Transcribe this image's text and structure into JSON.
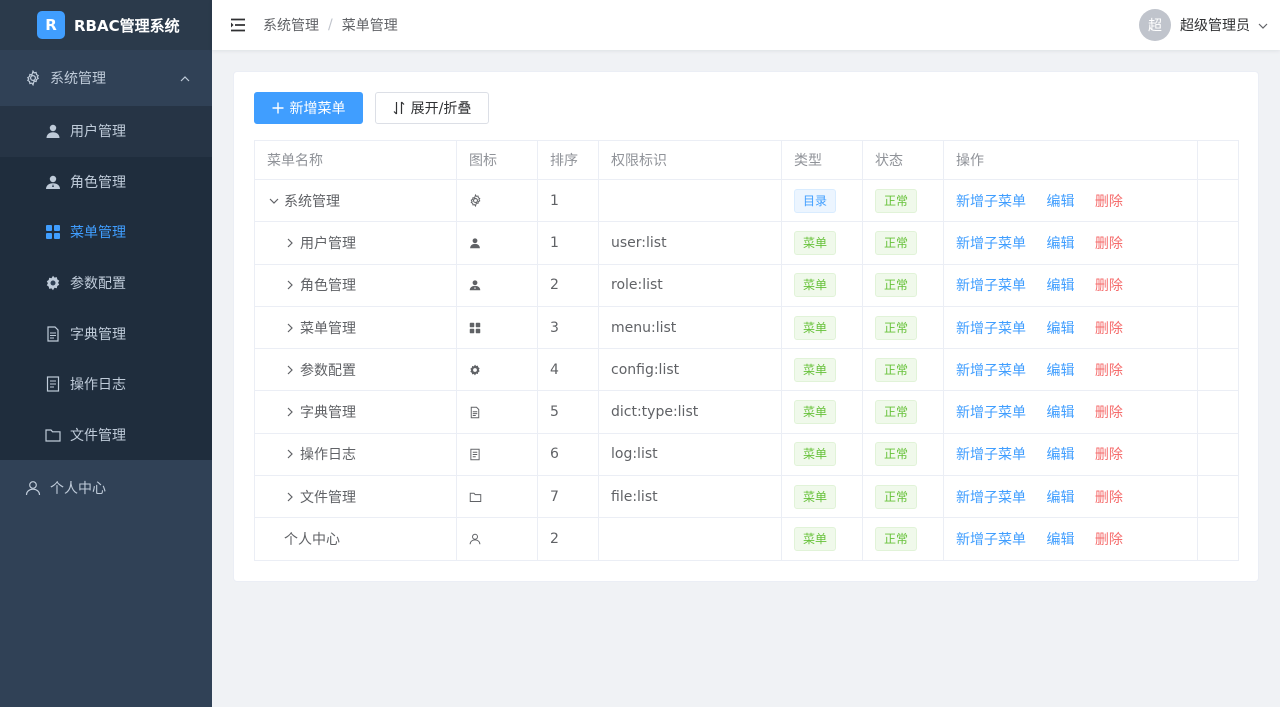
{
  "app": {
    "logo_letter": "R",
    "title": "RBAC管理系统"
  },
  "sidebar": {
    "group": {
      "label": "系统管理",
      "icon": "gear-icon"
    },
    "items": [
      {
        "label": "用户管理",
        "icon": "user-icon"
      },
      {
        "label": "角色管理",
        "icon": "user-group-icon"
      },
      {
        "label": "菜单管理",
        "icon": "grid-icon",
        "active": true
      },
      {
        "label": "参数配置",
        "icon": "settings-icon"
      },
      {
        "label": "字典管理",
        "icon": "document-icon"
      },
      {
        "label": "操作日志",
        "icon": "log-icon"
      },
      {
        "label": "文件管理",
        "icon": "folder-icon"
      }
    ],
    "personal": {
      "label": "个人中心",
      "icon": "person-icon"
    }
  },
  "header": {
    "breadcrumb": [
      "系统管理",
      "菜单管理"
    ],
    "separator": "/",
    "avatar_text": "超",
    "username": "超级管理员"
  },
  "toolbar": {
    "add_label": "新增菜单",
    "toggle_label": "展开/折叠"
  },
  "table": {
    "columns": [
      "菜单名称",
      "图标",
      "排序",
      "权限标识",
      "类型",
      "状态",
      "操作"
    ],
    "rows": [
      {
        "name": "系统管理",
        "icon": "gear-icon",
        "order": "1",
        "perm": "",
        "type": "目录",
        "status": "正常"
      },
      {
        "name": "用户管理",
        "icon": "user-icon",
        "order": "1",
        "perm": "user:list",
        "type": "菜单",
        "status": "正常"
      },
      {
        "name": "角色管理",
        "icon": "user-group-icon",
        "order": "2",
        "perm": "role:list",
        "type": "菜单",
        "status": "正常"
      },
      {
        "name": "菜单管理",
        "icon": "grid-icon",
        "order": "3",
        "perm": "menu:list",
        "type": "菜单",
        "status": "正常"
      },
      {
        "name": "参数配置",
        "icon": "settings-icon",
        "order": "4",
        "perm": "config:list",
        "type": "菜单",
        "status": "正常"
      },
      {
        "name": "字典管理",
        "icon": "document-icon",
        "order": "5",
        "perm": "dict:type:list",
        "type": "菜单",
        "status": "正常"
      },
      {
        "name": "操作日志",
        "icon": "log-icon",
        "order": "6",
        "perm": "log:list",
        "type": "菜单",
        "status": "正常"
      },
      {
        "name": "文件管理",
        "icon": "folder-icon",
        "order": "7",
        "perm": "file:list",
        "type": "菜单",
        "status": "正常"
      },
      {
        "name": "个人中心",
        "icon": "person-icon",
        "order": "2",
        "perm": "",
        "type": "菜单",
        "status": "正常"
      }
    ],
    "ops": {
      "add_child": "新增子菜单",
      "edit": "编辑",
      "delete": "删除"
    }
  },
  "colors": {
    "primary": "#409eff",
    "success": "#67c23a",
    "danger": "#f56c6c",
    "sidebar_bg": "#304156"
  }
}
